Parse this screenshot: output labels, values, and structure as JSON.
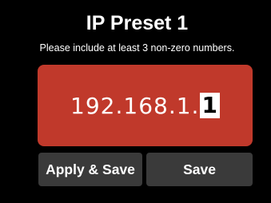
{
  "screen": {
    "title": "IP Preset 1",
    "hint": "Please include at least 3 non-zero numbers."
  },
  "ip_field": {
    "prefix": "192.168.1.",
    "cursor_char": "1",
    "background_color": "#c0392b"
  },
  "buttons": {
    "apply_save_label": "Apply & Save",
    "save_label": "Save"
  }
}
